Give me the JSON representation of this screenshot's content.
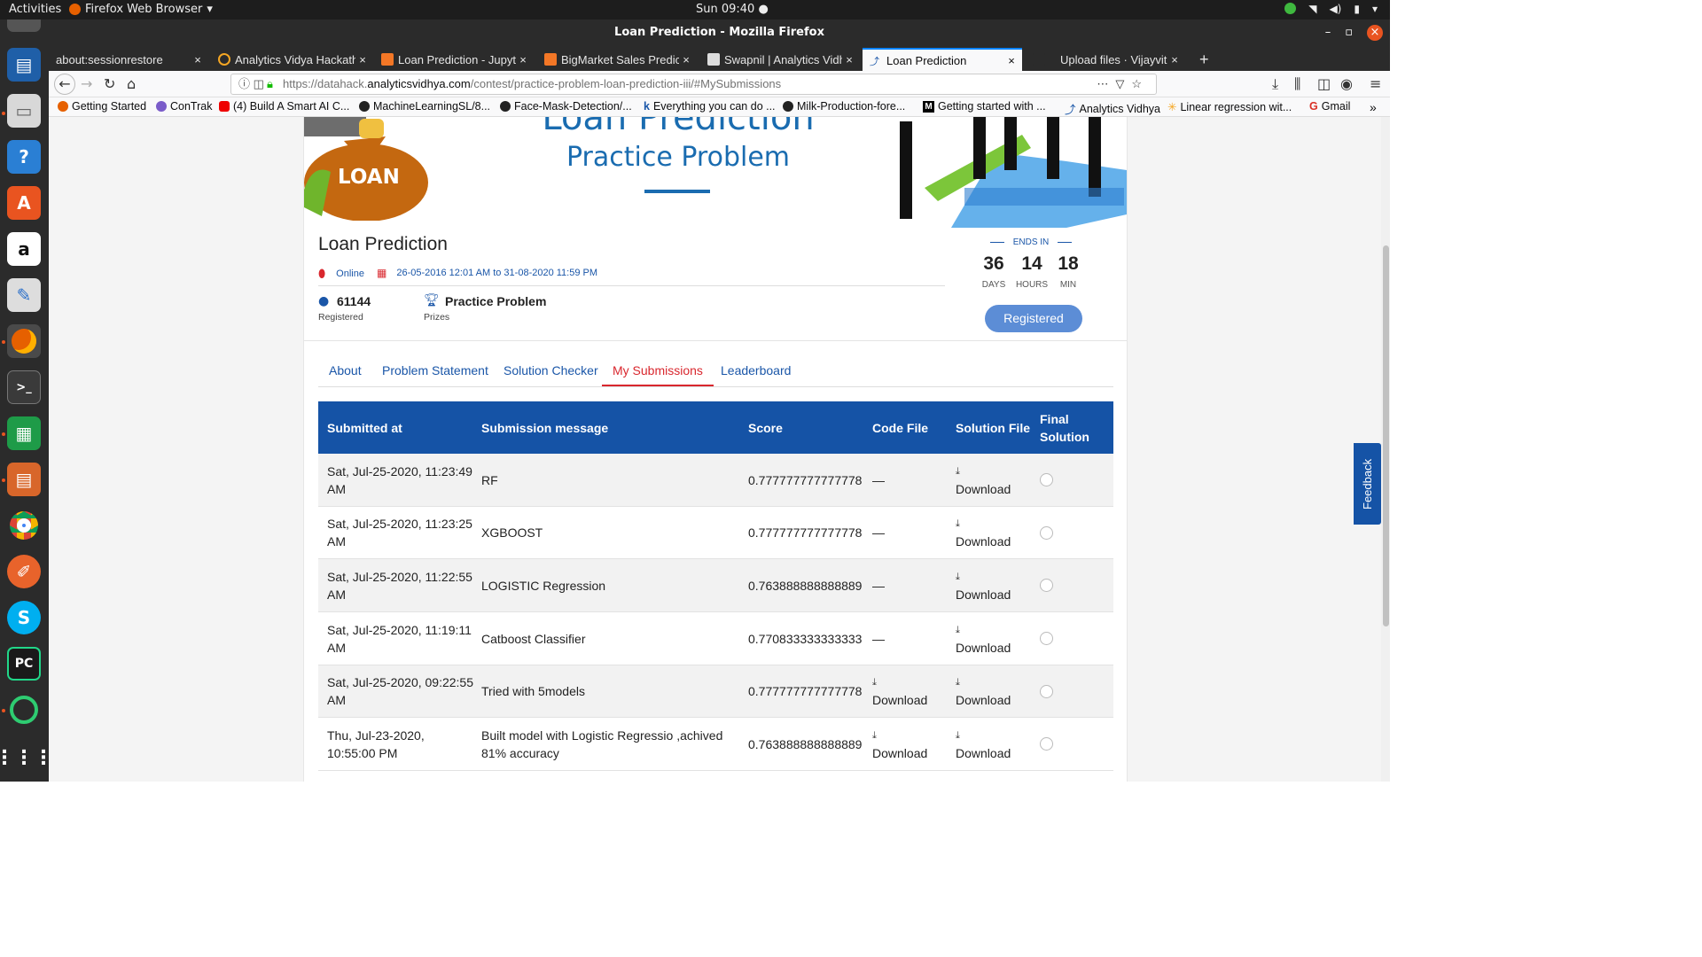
{
  "topbar": {
    "activities": "Activities",
    "app_menu": "Firefox Web Browser",
    "clock": "Sun 09:40 ●"
  },
  "window": {
    "title": "Loan Prediction - Mozilla Firefox"
  },
  "tabs": [
    {
      "label": "about:sessionrestore",
      "color": "#2b2b2b"
    },
    {
      "label": "Analytics Vidya Hackath",
      "color": "#f5a623"
    },
    {
      "label": "Loan Prediction - Jupyte",
      "color": "#f37726"
    },
    {
      "label": "BigMarket Sales Predicti",
      "color": "#f37726"
    },
    {
      "label": "Swapnil | Analytics Vidhy",
      "color": "#dddddd"
    },
    {
      "label": "Loan Prediction",
      "color": "#1a56a8"
    },
    {
      "label": "Upload files · Vijayvithal",
      "color": "#2b2b2b"
    }
  ],
  "url": {
    "prefix": "https://datahack.",
    "domain": "analyticsvidhya.com",
    "path": "/contest/practice-problem-loan-prediction-iii/#MySubmissions"
  },
  "bookmarks": [
    {
      "label": "Getting Started",
      "color": "#e66000"
    },
    {
      "label": "ConTrak",
      "color": "#7a5cc9"
    },
    {
      "label": "(4) Build A Smart AI C...",
      "color": "#e00"
    },
    {
      "label": "MachineLearningSL/8...",
      "color": "#222"
    },
    {
      "label": "Face-Mask-Detection/...",
      "color": "#222"
    },
    {
      "label": "Everything you can do ...",
      "color": "#1a56a8"
    },
    {
      "label": "Milk-Production-fore...",
      "color": "#222"
    },
    {
      "label": "Getting started with ...",
      "color": "#000"
    },
    {
      "label": "Analytics Vidhya",
      "color": "#1a56a8"
    },
    {
      "label": "Linear regression wit...",
      "color": "#f5a623"
    },
    {
      "label": "Gmail",
      "color": "#d93025"
    }
  ],
  "banner": {
    "title": "Loan Prediction",
    "subtitle": "Practice Problem",
    "bag_label": "LOAN"
  },
  "contest": {
    "title": "Loan Prediction",
    "location": "Online",
    "dates": "26-05-2016 12:01 AM to 31-08-2020 11:59 PM",
    "registered_count": "61144",
    "registered_label": "Registered",
    "prize": "Practice Problem",
    "prize_label": "Prizes",
    "ends_in": "ENDS IN",
    "days": "36",
    "days_label": "DAYS",
    "hours": "14",
    "hours_label": "HOURS",
    "min": "18",
    "min_label": "MIN",
    "button": "Registered"
  },
  "page_tabs": [
    "About",
    "Problem Statement",
    "Solution Checker",
    "My Submissions",
    "Leaderboard"
  ],
  "table": {
    "headers": [
      "Submitted at",
      "Submission message",
      "Score",
      "Code File",
      "Solution File",
      "Final Solution"
    ],
    "rows": [
      {
        "submitted": "Sat, Jul-25-2020, 11:23:49 AM",
        "message": "RF",
        "score": "0.777777777777778",
        "code": "—",
        "solution": "Download"
      },
      {
        "submitted": "Sat, Jul-25-2020, 11:23:25 AM",
        "message": "XGBOOST",
        "score": "0.777777777777778",
        "code": "—",
        "solution": "Download"
      },
      {
        "submitted": "Sat, Jul-25-2020, 11:22:55 AM",
        "message": "LOGISTIC Regression",
        "score": "0.763888888888889",
        "code": "—",
        "solution": "Download"
      },
      {
        "submitted": "Sat, Jul-25-2020, 11:19:11 AM",
        "message": "Catboost Classifier",
        "score": "0.770833333333333",
        "code": "—",
        "solution": "Download"
      },
      {
        "submitted": "Sat, Jul-25-2020, 09:22:55 AM",
        "message": "Tried with 5models",
        "score": "0.777777777777778",
        "code": "Download",
        "solution": "Download"
      },
      {
        "submitted": "Thu, Jul-23-2020, 10:55:00 PM",
        "message": "Built model with Logistic Regressio ,achived 81% accuracy",
        "score": "0.763888888888889",
        "code": "Download",
        "solution": "Download"
      }
    ]
  },
  "feedback": "Feedback"
}
